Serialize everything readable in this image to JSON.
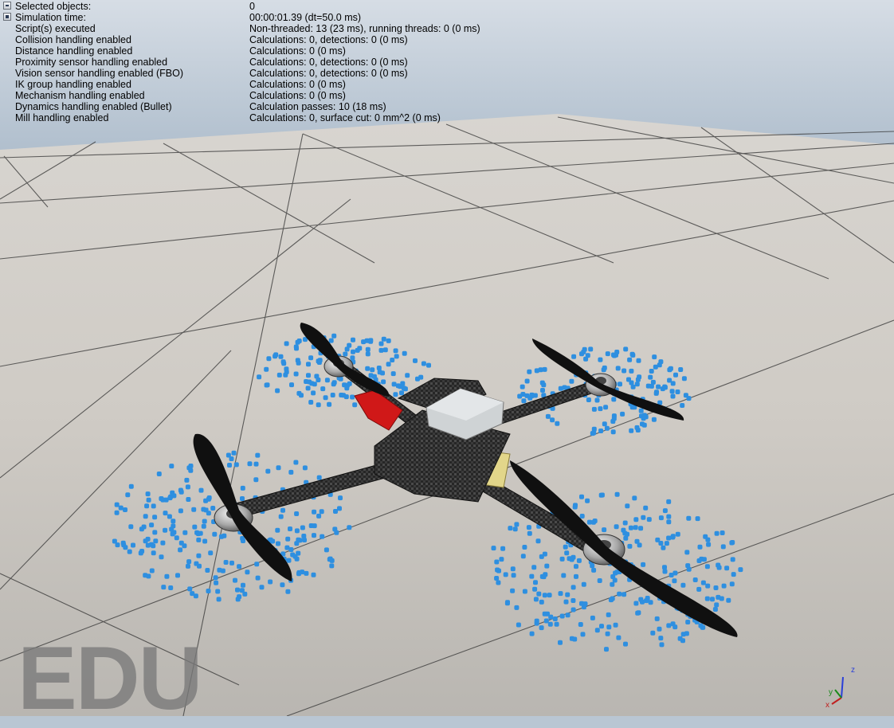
{
  "info_panel": {
    "rows": [
      {
        "label": "Selected objects:",
        "value": "0"
      },
      {
        "label": "Simulation time:",
        "value": "00:00:01.39 (dt=50.0 ms)"
      },
      {
        "label": "Script(s) executed",
        "value": "Non-threaded: 13 (23 ms), running threads: 0 (0 ms)"
      },
      {
        "label": "Collision handling enabled",
        "value": "Calculations: 0, detections: 0 (0 ms)"
      },
      {
        "label": "Distance handling enabled",
        "value": "Calculations: 0 (0 ms)"
      },
      {
        "label": "Proximity sensor handling enabled",
        "value": "Calculations: 0, detections: 0 (0 ms)"
      },
      {
        "label": "Vision sensor handling enabled (FBO)",
        "value": "Calculations: 0, detections: 0 (0 ms)"
      },
      {
        "label": "IK group handling enabled",
        "value": "Calculations: 0 (0 ms)"
      },
      {
        "label": "Mechanism handling enabled",
        "value": "Calculations: 0 (0 ms)"
      },
      {
        "label": "Dynamics handling enabled (Bullet)",
        "value": "Calculation passes: 10 (18 ms)"
      },
      {
        "label": "Mill handling enabled",
        "value": "Calculations: 0, surface cut: 0 mm^2 (0 ms)"
      }
    ]
  },
  "watermark": "EDU",
  "axis_gizmo": {
    "z": "z",
    "y": "y",
    "x": "x"
  },
  "colors": {
    "sky_top": "#b3c1d0",
    "floor_tile": "#d4d0ca",
    "particles": "#2e8fe0",
    "frame": "#222222",
    "mount_red": "#d01818",
    "plate_yellow": "#e2d68a"
  }
}
